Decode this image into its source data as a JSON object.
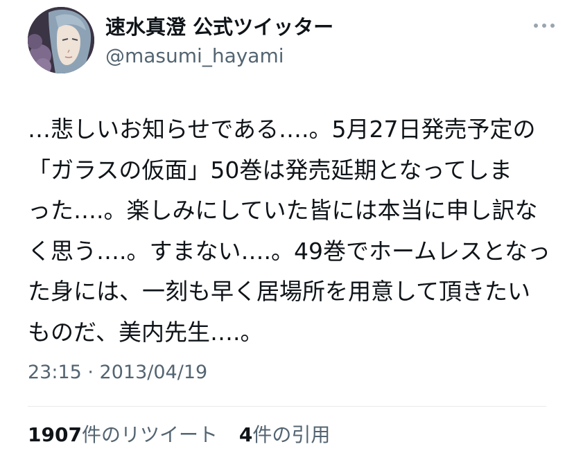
{
  "author": {
    "display_name": "速水真澄 公式ツイッター",
    "handle": "@masumi_hayami",
    "avatar_icon": "avatar-portrait"
  },
  "more_icon": "more-horizontal-icon",
  "tweet": {
    "lines": [
      "…悲しいお知らせである….。5月27日発売予定の",
      "「ガラスの仮面」50巻は発売延期となってしま",
      "った….。楽しみにしていた皆には本当に申し訳な",
      "く思う….。すまない….。49巻でホームレスとなっ",
      "た身には、一刻も早く居場所を用意して頂きたい",
      "ものだ、美内先生….。"
    ],
    "timestamp": "23:15 · 2013/04/19"
  },
  "stats": {
    "retweets_count": "1907",
    "retweets_label": "件のリツイート",
    "quotes_count": "4",
    "quotes_label": "件の引用"
  },
  "colors": {
    "text_primary": "#0f1419",
    "text_secondary": "#536471",
    "divider": "#e6e9ec"
  }
}
